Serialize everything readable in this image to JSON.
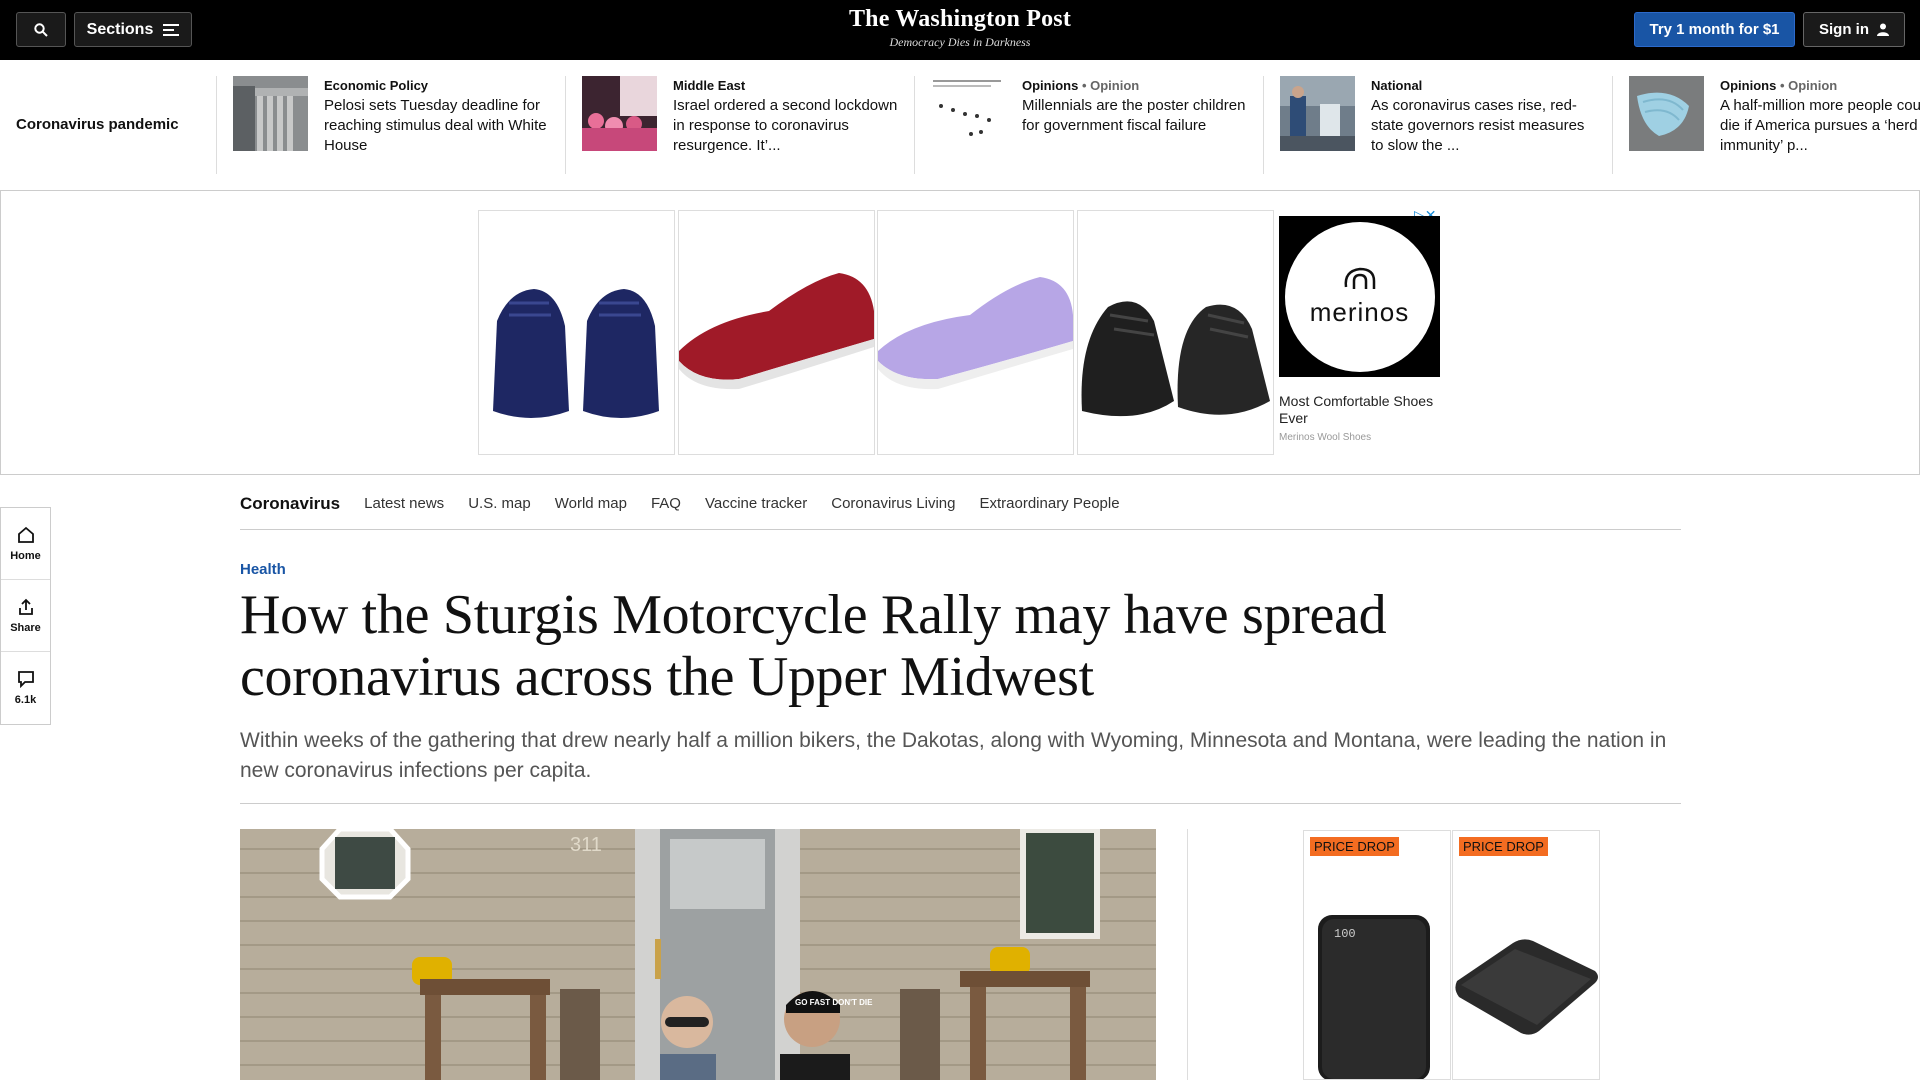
{
  "header": {
    "sections_label": "Sections",
    "logo_name": "The Washington Post",
    "logo_tagline": "Democracy Dies in Darkness",
    "subscribe_label": "Try 1 month for $1",
    "signin_label": "Sign in"
  },
  "strip": {
    "label": "Coronavirus pandemic",
    "items": [
      {
        "kicker": "Economic Policy",
        "opinion": "",
        "headline": "Pelosi sets Tuesday deadline for reaching stimulus deal with White House"
      },
      {
        "kicker": "Middle East",
        "opinion": "",
        "headline": "Israel ordered a second lockdown in response to coronavirus resurgence. It’..."
      },
      {
        "kicker": "Opinions",
        "opinion": "• Opinion",
        "headline": "Millennials are the poster children for government fiscal failure"
      },
      {
        "kicker": "National",
        "opinion": "",
        "headline": "As coronavirus cases rise, red-state governors resist measures to slow the ..."
      },
      {
        "kicker": "Opinions",
        "opinion": "• Opinion",
        "headline": "A half-million more people could die if America pursues a ‘herd immunity’ p..."
      }
    ]
  },
  "top_ad": {
    "brand": "merinos",
    "title": "Most Comfortable Shoes Ever",
    "sponsor": "Merinos Wool Shoes"
  },
  "rail": {
    "home": "Home",
    "share": "Share",
    "comments": "6.1k"
  },
  "subnav": {
    "home": "Coronavirus",
    "links": [
      "Latest news",
      "U.S. map",
      "World map",
      "FAQ",
      "Vaccine tracker",
      "Coronavirus Living",
      "Extraordinary People"
    ]
  },
  "article": {
    "kicker": "Health",
    "headline": "How the Sturgis Motorcycle Rally may have spread coronavirus across the Upper Midwest",
    "dek": "Within weeks of the gathering that drew nearly half a million bikers, the Dakotas, along with Wyoming, Minnesota and Montana, were leading the nation in new coronavirus infections per capita."
  },
  "hero_photo": {
    "house_number": "311",
    "cap_text": "GO FAST DON'T DIE"
  },
  "right_ad": {
    "tag1": "PRICE DROP",
    "tag2": "PRICE DROP",
    "screen_text": "100"
  },
  "colors": {
    "accent": "#1955a5",
    "topbar": "#000000",
    "price_tag": "#f36c21"
  }
}
